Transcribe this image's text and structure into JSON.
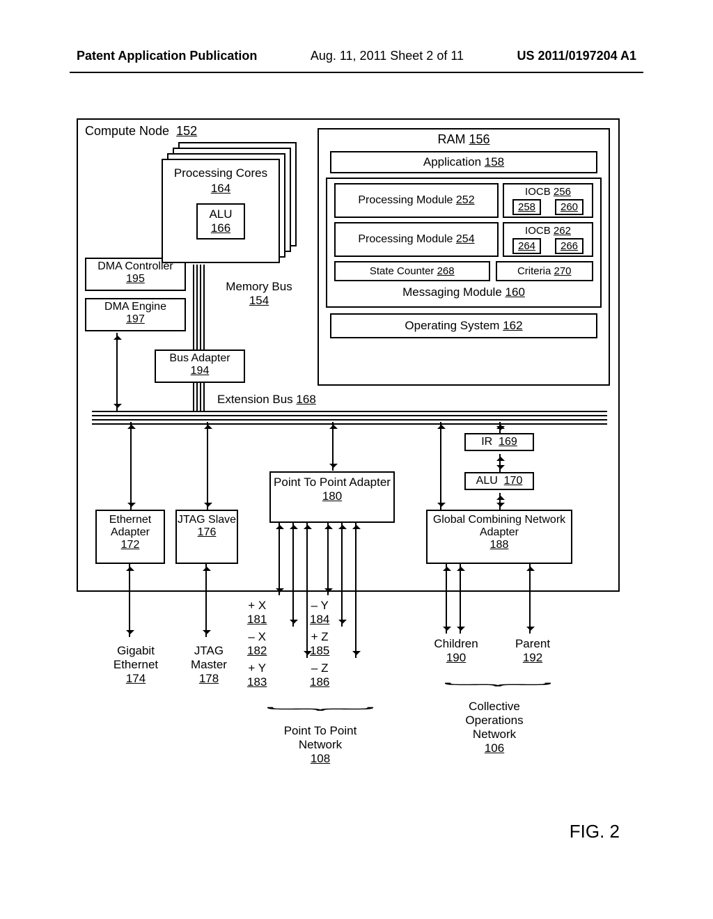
{
  "header": {
    "left": "Patent Application Publication",
    "mid": "Aug. 11, 2011  Sheet 2 of 11",
    "right": "US 2011/0197204 A1"
  },
  "node": {
    "label": "Compute Node",
    "ref": "152"
  },
  "cores": {
    "title": "Processing Cores",
    "ref": "164",
    "alu": "ALU",
    "alu_ref": "166"
  },
  "ram": {
    "title": "RAM",
    "ref": "156"
  },
  "app": {
    "label": "Application",
    "ref": "158"
  },
  "pm1": {
    "label": "Processing Module",
    "ref": "252"
  },
  "pm2": {
    "label": "Processing Module",
    "ref": "254"
  },
  "iocb1": {
    "label": "IOCB",
    "ref": "256",
    "a": "258",
    "b": "260"
  },
  "iocb2": {
    "label": "IOCB",
    "ref": "262",
    "a": "264",
    "b": "266"
  },
  "state": {
    "label": "State Counter",
    "ref": "268"
  },
  "criteria": {
    "label": "Criteria",
    "ref": "270"
  },
  "msgmod": {
    "label": "Messaging Module",
    "ref": "160"
  },
  "os": {
    "label": "Operating System",
    "ref": "162"
  },
  "dmactrl": {
    "label": "DMA Controller",
    "ref": "195"
  },
  "dmaeng": {
    "label": "DMA Engine",
    "ref": "197"
  },
  "membus": {
    "label": "Memory Bus",
    "ref": "154"
  },
  "busadapter": {
    "label": "Bus Adapter",
    "ref": "194"
  },
  "extbus": {
    "label": "Extension Bus",
    "ref": "168"
  },
  "ir": {
    "label": "IR",
    "ref": "169"
  },
  "alu2": {
    "label": "ALU",
    "ref": "170"
  },
  "p2p": {
    "label": "Point To Point Adapter",
    "ref": "180"
  },
  "gcn": {
    "label": "Global Combining Network Adapter",
    "ref": "188"
  },
  "eth": {
    "label": "Ethernet Adapter",
    "ref": "172"
  },
  "jtag": {
    "label": "JTAG Slave",
    "ref": "176"
  },
  "gige": {
    "label": "Gigabit Ethernet",
    "ref": "174"
  },
  "jtagm": {
    "label": "JTAG Master",
    "ref": "178"
  },
  "px": {
    "label": "+ X",
    "ref": "181"
  },
  "nx": {
    "label": "– X",
    "ref": "182"
  },
  "py": {
    "label": "+ Y",
    "ref": "183"
  },
  "ny": {
    "label": "– Y",
    "ref": "184"
  },
  "pz": {
    "label": "+ Z",
    "ref": "185"
  },
  "nz": {
    "label": "– Z",
    "ref": "186"
  },
  "children": {
    "label": "Children",
    "ref": "190"
  },
  "parent": {
    "label": "Parent",
    "ref": "192"
  },
  "p2pnet": {
    "label": "Point To Point Network",
    "ref": "108"
  },
  "conet": {
    "label": "Collective Operations Network",
    "ref": "106"
  },
  "figlabel": "FIG. 2"
}
